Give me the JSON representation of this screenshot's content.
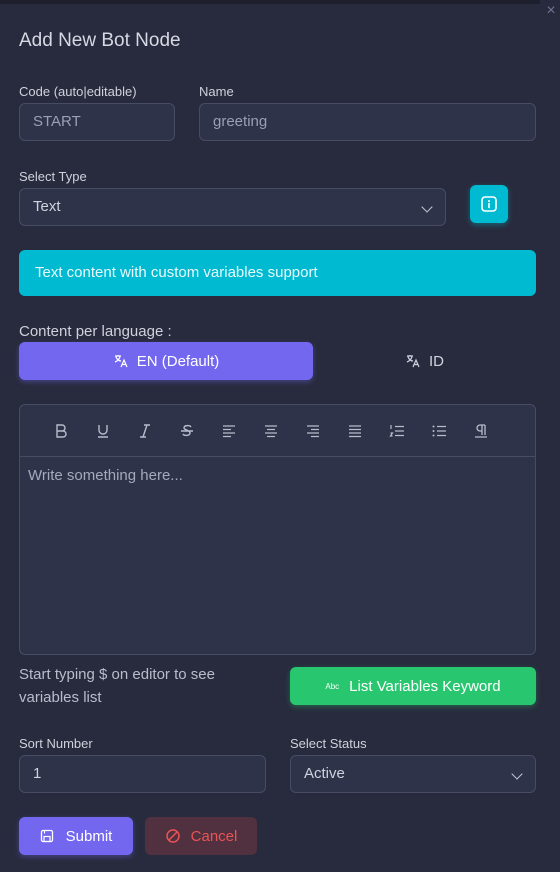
{
  "modal": {
    "title": "Add New Bot Node",
    "close_glyph": "×"
  },
  "form": {
    "code": {
      "label": "Code (auto|editable)",
      "placeholder": "START"
    },
    "name": {
      "label": "Name",
      "placeholder": "greeting"
    },
    "type": {
      "label": "Select Type",
      "value": "Text"
    },
    "type_description": "Text content with custom variables support",
    "content_label": "Content per language :",
    "languages": [
      {
        "label": "EN (Default)",
        "active": true
      },
      {
        "label": "ID",
        "active": false
      }
    ],
    "editor": {
      "placeholder": "Write something here...",
      "toolbar": [
        "bold-icon",
        "underline-icon",
        "italic-icon",
        "strikethrough-icon",
        "align-left-icon",
        "align-center-icon",
        "align-right-icon",
        "align-justify-icon",
        "ordered-list-icon",
        "bullet-list-icon",
        "paragraph-icon"
      ]
    },
    "variables_hint": "Start typing $ on editor to see variables list",
    "variables_button": "List Variables Keyword",
    "variables_icon_text": "Abc",
    "sort": {
      "label": "Sort Number",
      "value": "1"
    },
    "status": {
      "label": "Select Status",
      "value": "Active"
    }
  },
  "actions": {
    "submit": "Submit",
    "cancel": "Cancel"
  },
  "colors": {
    "primary": "#7367f0",
    "info": "#00bad1",
    "success": "#28c76f",
    "danger": "#ea5455",
    "background": "#282b3d"
  }
}
